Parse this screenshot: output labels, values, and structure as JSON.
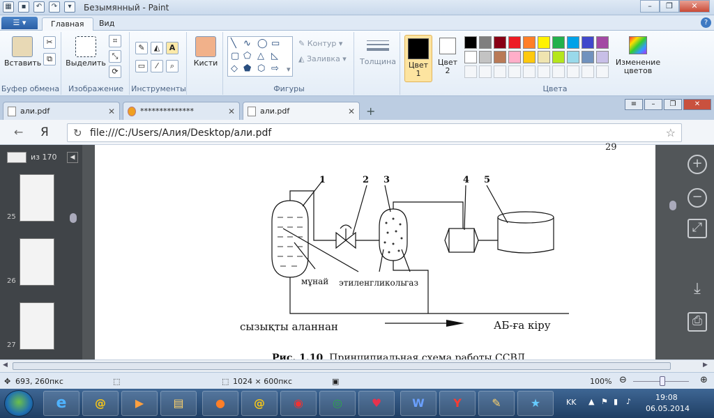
{
  "app": {
    "title": "Безымянный - Paint"
  },
  "ribbon": {
    "file_label": "☰ ▾",
    "tabs": [
      "Главная",
      "Вид"
    ],
    "help": "?",
    "groups": {
      "clipboard": {
        "label": "Буфер обмена",
        "paste": "Вставить"
      },
      "image": {
        "label": "Изображение",
        "select": "Выделить"
      },
      "tools": {
        "label": "Инструменты"
      },
      "brushes": {
        "label": "Кисти"
      },
      "shapes": {
        "label": "Фигуры",
        "outline": "Контур",
        "fill": "Заливка"
      },
      "thickness": {
        "label": "Толщина"
      },
      "colors": {
        "label": "Цвета",
        "color1": "Цвет 1",
        "color1_line1": "Цвет",
        "color1_line2": "1",
        "color2_line1": "Цвет",
        "color2_line2": "2",
        "edit_line1": "Изменение",
        "edit_line2": "цветов"
      }
    },
    "palette": [
      "#000000",
      "#7f7f7f",
      "#880015",
      "#ed1c24",
      "#ff7f27",
      "#fff200",
      "#22b14c",
      "#00a2e8",
      "#3f48cc",
      "#a349a4",
      "#ffffff",
      "#c3c3c3",
      "#b97a57",
      "#ffaec9",
      "#ffc90e",
      "#efe4b0",
      "#b5e61d",
      "#99d9ea",
      "#7092be",
      "#c8bfe7"
    ],
    "color1_value": "#000000",
    "color2_value": "#ffffff"
  },
  "browser": {
    "tabs": [
      {
        "label": "али.pdf"
      },
      {
        "label": "**************"
      },
      {
        "label": "али.pdf"
      }
    ],
    "new_tab": "+",
    "url": "file:///C:/Users/Алия/Desktop/али.pdf",
    "back": "←",
    "yandex": "Я"
  },
  "pdf": {
    "page_input": "",
    "page_total": "из 170",
    "page_number": "29",
    "thumbs": [
      "25",
      "26",
      "27"
    ],
    "diagram": {
      "labels": [
        "1",
        "2",
        "3",
        "4",
        "5"
      ],
      "text_oil": "мұнай",
      "text_glycol": "этиленгликоль",
      "text_gas": "газ",
      "text_from": "сызықты аланнан",
      "text_to": "АБ-ға кіру"
    },
    "caption_bold": "Рис. 1.10",
    "caption_rest": ". Принципиальная схема работы ССВД."
  },
  "status": {
    "coords": "693, 260пкс",
    "size": "1024 × 600пкс",
    "zoom": "100%"
  },
  "taskbar": {
    "lang": "KK",
    "time": "19:08",
    "date": "06.05.2014"
  }
}
